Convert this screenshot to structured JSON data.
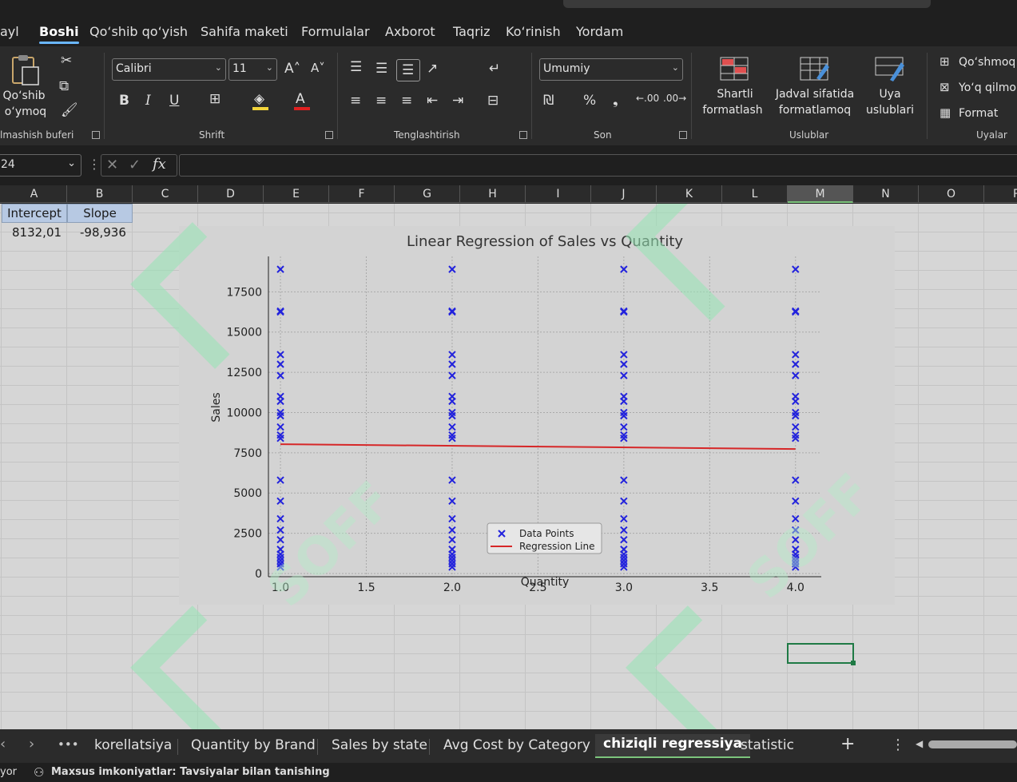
{
  "ribbon_tabs": [
    "ayl",
    "Boshi",
    "Qo‘shib qo‘yish",
    "Sahifa maketi",
    "Formulalar",
    "Axborot",
    "Taqriz",
    "Ko‘rinish",
    "Yordam"
  ],
  "clipboard": {
    "paste_label_1": "Qo‘shib",
    "paste_label_2": "o‘ymoq",
    "group_label": "lmashish buferi"
  },
  "font": {
    "family": "Calibri",
    "size": "11",
    "group_label": "Shrift"
  },
  "alignment": {
    "group_label": "Tenglashtirish"
  },
  "number": {
    "format": "Umumiy",
    "group_label": "Son"
  },
  "styles": {
    "conditional_1": "Shartli",
    "conditional_2": "formatlash",
    "table_1": "Jadval sifatida",
    "table_2": "formatlamoq",
    "cell_1": "Uya",
    "cell_2": "uslublari",
    "group_label": "Uslublar"
  },
  "cells_group": {
    "insert": "Qo‘shmoq",
    "delete": "Yo‘q qilmo",
    "format": "Format",
    "group_label": "Uyalar"
  },
  "formula_bar": {
    "name_box": "24",
    "fx": "fx"
  },
  "columns": [
    "A",
    "B",
    "C",
    "D",
    "E",
    "F",
    "G",
    "H",
    "I",
    "J",
    "K",
    "L",
    "M",
    "N",
    "O",
    "P"
  ],
  "cells": {
    "a1": "Intercept",
    "b1": "Slope",
    "a2": "8132,01",
    "b2": "-98,936"
  },
  "chart_data": {
    "type": "scatter",
    "title": "Linear Regression of Sales vs Quantity",
    "xlabel": "Quantity",
    "ylabel": "Sales",
    "xlim": [
      0.93,
      4.15
    ],
    "ylim": [
      -200,
      19700
    ],
    "xticks": [
      "1.0",
      "1.5",
      "2.0",
      "2.5",
      "3.0",
      "3.5",
      "4.0"
    ],
    "xtick_values": [
      1.0,
      1.5,
      2.0,
      2.5,
      3.0,
      3.5,
      4.0
    ],
    "yticks": [
      "0",
      "2500",
      "5000",
      "7500",
      "10000",
      "12500",
      "15000",
      "17500"
    ],
    "ytick_values": [
      0,
      2500,
      5000,
      7500,
      10000,
      12500,
      15000,
      17500
    ],
    "grid": true,
    "legend_position": "bottom-center",
    "series": [
      {
        "name": "Data Points",
        "kind": "scatter",
        "marker": "x",
        "color": "#2222dd",
        "x_values": [
          1,
          2,
          3,
          4
        ],
        "y_values": [
          18900,
          16300,
          16250,
          13600,
          13000,
          12300,
          11000,
          10700,
          10000,
          9800,
          9100,
          8600,
          8400,
          5800,
          4500,
          3400,
          2700,
          2100,
          1500,
          1200,
          1000,
          800,
          600,
          400
        ]
      },
      {
        "name": "Regression Line",
        "kind": "line",
        "color": "#d62728",
        "x": [
          1,
          4
        ],
        "y": [
          8033.07,
          7736.26
        ]
      }
    ]
  },
  "sheet_tabs": [
    "korellatsiya",
    "Quantity by Brand",
    "Sales by state",
    "Avg Cost by Category",
    "chiziqli regressiya",
    "statistic"
  ],
  "active_sheet": "chiziqli regressiya",
  "status": {
    "left": "yor",
    "accessibility": "Maxsus imkoniyatlar: Tavsiyalar bilan tanishing"
  },
  "watermark": "SOFF"
}
